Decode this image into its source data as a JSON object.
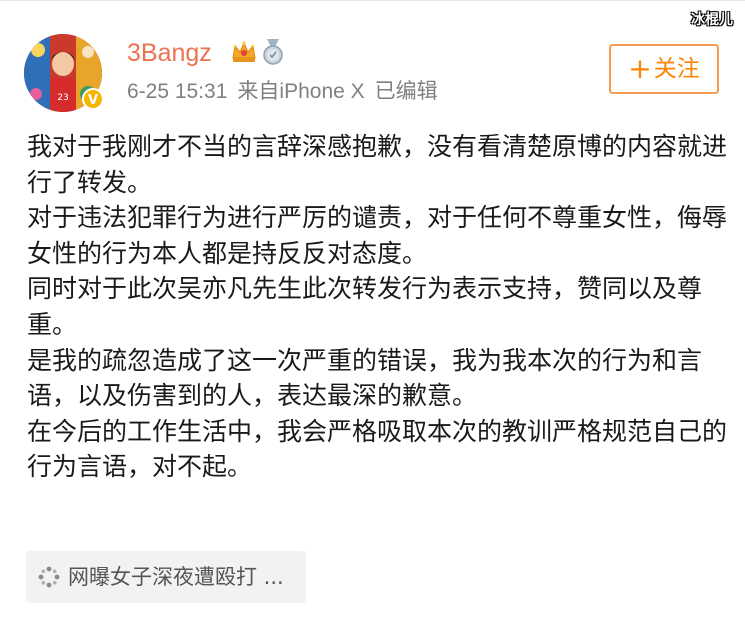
{
  "watermark": "冰棍儿",
  "post": {
    "username": "3Bangz",
    "timestamp": "6-25 15:31",
    "source_prefix": "来自",
    "source_device": "iPhone X",
    "edited_label": "已编辑",
    "follow_button": {
      "plus": "+",
      "label": "关注"
    },
    "paragraphs": [
      "我对于我刚才不当的言辞深感抱歉，没有看清楚原博的内容就进行了转发。",
      "对于违法犯罪行为进行严厉的谴责，对于任何不尊重女性，侮辱女性的行为本人都是持反反对态度。",
      "同时对于此次吴亦凡先生此次转发行为表示支持，赞同以及尊重。",
      "是我的疏忽造成了这一次严重的错误，我为我本次的行为和言语，以及伤害到的人，表达最深的歉意。",
      "在今后的工作生活中，我会严格吸取本次的教训严格规范自己的行为言语，对不起。"
    ],
    "link_card": {
      "icon": "link-icon",
      "text": "网曝女子深夜遭殴打 ..."
    },
    "icons": {
      "crown_badge": "crown-badge-icon",
      "medal_badge": "medal-badge-icon",
      "verified": "verified-icon"
    },
    "colors": {
      "username": "#eb7350",
      "follow_accent": "#ff8200",
      "meta_text": "#808080",
      "body_text": "#1a1a1a",
      "verified": "#f7b500"
    }
  }
}
